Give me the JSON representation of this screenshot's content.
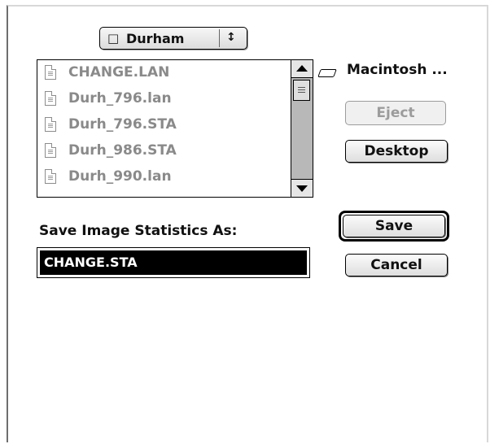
{
  "location_popup": {
    "label": "Durham",
    "updown_glyph": "↕"
  },
  "file_list": {
    "files": [
      {
        "name": "CHANGE.LAN"
      },
      {
        "name": "Durh_796.lan"
      },
      {
        "name": "Durh_796.STA"
      },
      {
        "name": "Durh_986.STA"
      },
      {
        "name": "Durh_990.lan"
      }
    ]
  },
  "volume": {
    "label": "Macintosh ..."
  },
  "buttons": {
    "eject": "Eject",
    "desktop": "Desktop",
    "save": "Save",
    "cancel": "Cancel"
  },
  "save_as": {
    "label": "Save Image Statistics As:",
    "value": "CHANGE.STA"
  },
  "colors": {
    "disabled_text": "#9c9c9c",
    "selection": "#000000",
    "file_text": "#8a8a8a"
  }
}
